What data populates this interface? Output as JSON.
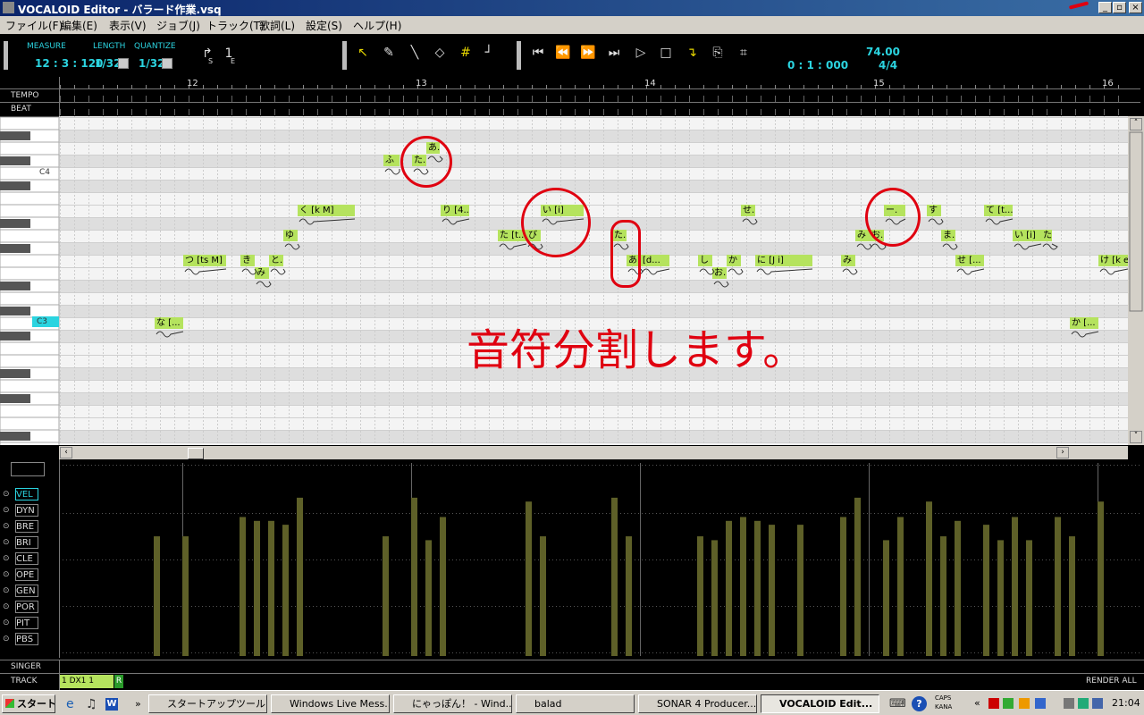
{
  "window": {
    "title": "VOCALOID Editor - バラード作業.vsq",
    "min": "_",
    "max": "▫",
    "close": "×"
  },
  "menu": [
    "ファイル(F)",
    "編集(E)",
    "表示(V)",
    "ジョブ(J)",
    "トラック(T)",
    "歌詞(L)",
    "設定(S)",
    "ヘルプ(H)"
  ],
  "toolbar": {
    "measure_label": "MEASURE",
    "length_label": "LENGTH",
    "quantize_label": "QUANTIZE",
    "measure_value": "12 : 3 : 120",
    "length_value": "1/32",
    "quantize_value": "1/32",
    "s_label": "S",
    "e_label": "E",
    "time_value": "0 : 1 : 000",
    "tempo_value": "74.00",
    "beat_value": "4/4"
  },
  "ruler": {
    "tempo_label": "TEMPO",
    "beat_label": "BEAT",
    "measures": [
      "12",
      "13",
      "14",
      "15",
      "16"
    ]
  },
  "keys": {
    "c4": "C4",
    "c3": "C3"
  },
  "notes": [
    {
      "text": "あ."
    },
    {
      "text": "ふ"
    },
    {
      "text": "た."
    },
    {
      "text": "く [k M]"
    },
    {
      "text": "り [4..."
    },
    {
      "text": "い [i]"
    },
    {
      "text": "ゆ"
    },
    {
      "text": "た [t..."
    },
    {
      "text": "び"
    },
    {
      "text": "つ [ts M]"
    },
    {
      "text": "き"
    },
    {
      "text": "と."
    },
    {
      "text": "み"
    },
    {
      "text": "た."
    },
    {
      "text": "あ ["
    },
    {
      "text": "[d..."
    },
    {
      "text": "し"
    },
    {
      "text": "か"
    },
    {
      "text": "お."
    },
    {
      "text": "に [J i]"
    },
    {
      "text": "み"
    },
    {
      "text": "せ."
    },
    {
      "text": "み"
    },
    {
      "text": "お."
    },
    {
      "text": "ー."
    },
    {
      "text": "す"
    },
    {
      "text": "て [t..."
    },
    {
      "text": "ま."
    },
    {
      "text": "い [i]"
    },
    {
      "text": "た"
    },
    {
      "text": "せ [..."
    },
    {
      "text": "け [k e"
    },
    {
      "text": "な [..."
    },
    {
      "text": "か [..."
    }
  ],
  "controls": [
    "VEL",
    "DYN",
    "BRE",
    "BRI",
    "CLE",
    "OPE",
    "GEN",
    "POR",
    "PIT",
    "PBS"
  ],
  "bottom": {
    "singer_label": "SINGER",
    "track_label": "TRACK",
    "track_name": "1 DX1 1",
    "track_flag": "R",
    "render_all": "RENDER ALL"
  },
  "annotation": "音符分割します。",
  "taskbar": {
    "start": "スタート",
    "tasks": [
      "スタートアップツール",
      "Windows Live Mess...",
      "にゃっぽん！ - Wind...",
      "balad",
      "SONAR 4 Producer...",
      "VOCALOID Edit..."
    ],
    "caps": "CAPS",
    "kana": "KANA",
    "clock": "21:04"
  },
  "velocities": [
    62,
    62,
    72,
    70,
    70,
    68,
    82,
    62,
    82,
    60,
    72,
    80,
    62,
    82,
    62,
    62,
    60,
    70,
    72,
    70,
    68,
    68,
    72,
    82,
    60,
    72,
    80,
    62,
    70,
    68,
    60,
    72,
    60,
    72,
    62,
    80
  ],
  "colors": {
    "note": "#b5e35e",
    "cyan": "#2bd4e0",
    "annotation": "#e00010",
    "vel_bar": "#5e6028"
  }
}
